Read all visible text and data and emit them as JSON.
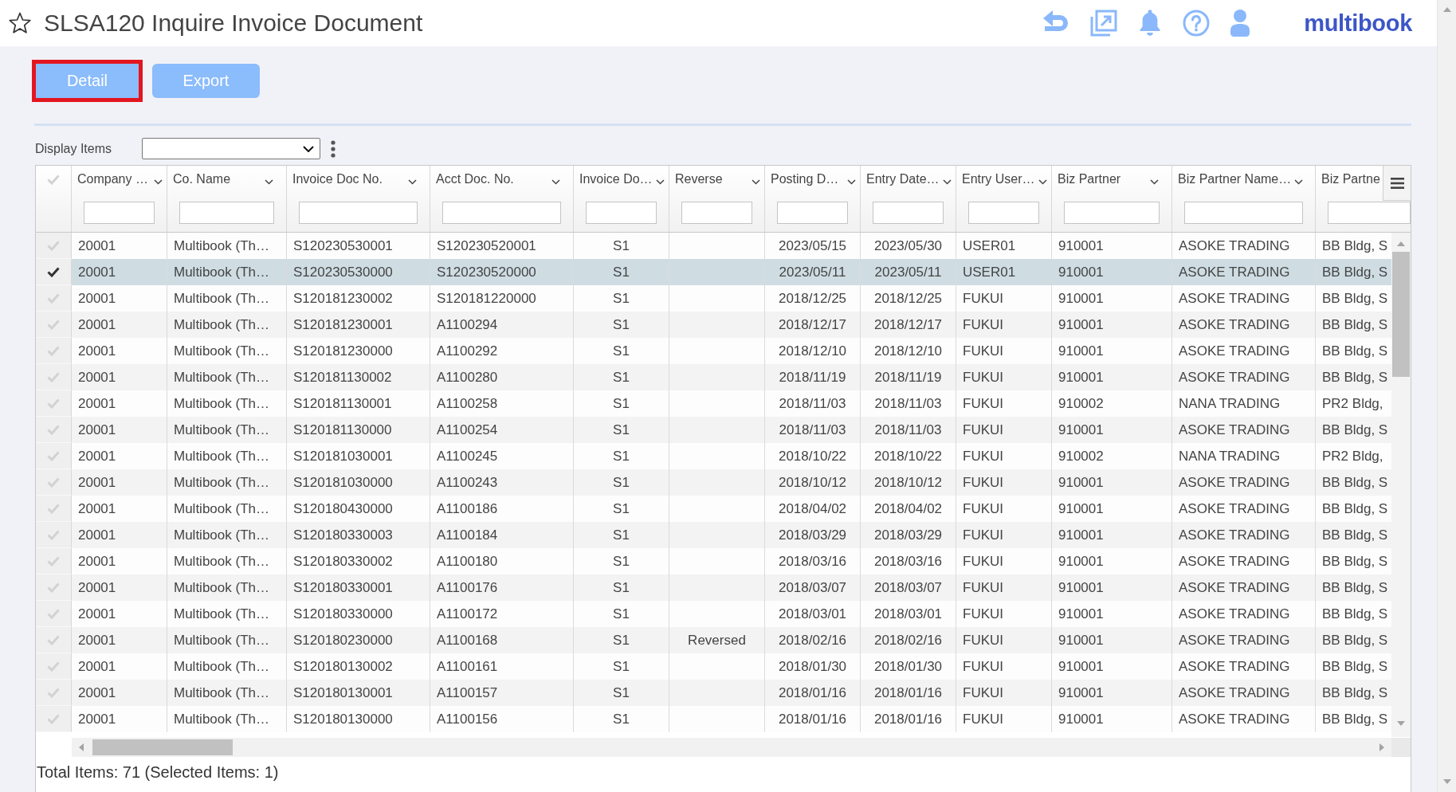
{
  "header": {
    "favorite": false,
    "title": "SLSA120 Inquire Invoice Document",
    "logo": "multibook"
  },
  "toolbar": {
    "buttons": [
      {
        "label": "Detail",
        "focused": true
      },
      {
        "label": "Export",
        "focused": false
      }
    ]
  },
  "display_items": {
    "label": "Display Items"
  },
  "table": {
    "select_all_checked": false,
    "columns": [
      {
        "label": "Company …"
      },
      {
        "label": "Co. Name"
      },
      {
        "label": "Invoice Doc No."
      },
      {
        "label": "Acct Doc. No."
      },
      {
        "label": "Invoice Do…"
      },
      {
        "label": "Reverse"
      },
      {
        "label": "Posting D…"
      },
      {
        "label": "Entry Date…"
      },
      {
        "label": "Entry User…"
      },
      {
        "label": "Biz Partner"
      },
      {
        "label": "Biz Partner Name…"
      },
      {
        "label": "Biz Partne"
      }
    ],
    "rows": [
      {
        "selected": false,
        "company": "20001",
        "co_name": "Multibook (Th…",
        "invoice_doc_no": "S120230530001",
        "acct_doc_no": "S120230520001",
        "invoice_do": "S1",
        "posting_d": "2023/05/15",
        "entry_date": "2023/05/30",
        "entry_user": "USER01",
        "biz_partner": "910001",
        "biz_partner_name": "ASOKE TRADING",
        "biz_partne": "BB Bldg, S"
      },
      {
        "selected": true,
        "company": "20001",
        "co_name": "Multibook (Th…",
        "invoice_doc_no": "S120230530000",
        "acct_doc_no": "S120230520000",
        "invoice_do": "S1",
        "posting_d": "2023/05/11",
        "entry_date": "2023/05/11",
        "entry_user": "USER01",
        "biz_partner": "910001",
        "biz_partner_name": "ASOKE TRADING",
        "biz_partne": "BB Bldg, S"
      },
      {
        "selected": false,
        "company": "20001",
        "co_name": "Multibook (Th…",
        "invoice_doc_no": "S120181230002",
        "acct_doc_no": "S120181220000",
        "invoice_do": "S1",
        "posting_d": "2018/12/25",
        "entry_date": "2018/12/25",
        "entry_user": "FUKUI",
        "biz_partner": "910001",
        "biz_partner_name": "ASOKE TRADING",
        "biz_partne": "BB Bldg, S"
      },
      {
        "selected": false,
        "company": "20001",
        "co_name": "Multibook (Th…",
        "invoice_doc_no": "S120181230001",
        "acct_doc_no": "A1100294",
        "invoice_do": "S1",
        "posting_d": "2018/12/17",
        "entry_date": "2018/12/17",
        "entry_user": "FUKUI",
        "biz_partner": "910001",
        "biz_partner_name": "ASOKE TRADING",
        "biz_partne": "BB Bldg, S"
      },
      {
        "selected": false,
        "company": "20001",
        "co_name": "Multibook (Th…",
        "invoice_doc_no": "S120181230000",
        "acct_doc_no": "A1100292",
        "invoice_do": "S1",
        "posting_d": "2018/12/10",
        "entry_date": "2018/12/10",
        "entry_user": "FUKUI",
        "biz_partner": "910001",
        "biz_partner_name": "ASOKE TRADING",
        "biz_partne": "BB Bldg, S"
      },
      {
        "selected": false,
        "company": "20001",
        "co_name": "Multibook (Th…",
        "invoice_doc_no": "S120181130002",
        "acct_doc_no": "A1100280",
        "invoice_do": "S1",
        "posting_d": "2018/11/19",
        "entry_date": "2018/11/19",
        "entry_user": "FUKUI",
        "biz_partner": "910001",
        "biz_partner_name": "ASOKE TRADING",
        "biz_partne": "BB Bldg, S"
      },
      {
        "selected": false,
        "company": "20001",
        "co_name": "Multibook (Th…",
        "invoice_doc_no": "S120181130001",
        "acct_doc_no": "A1100258",
        "invoice_do": "S1",
        "posting_d": "2018/11/03",
        "entry_date": "2018/11/03",
        "entry_user": "FUKUI",
        "biz_partner": "910002",
        "biz_partner_name": "NANA TRADING",
        "biz_partne": "PR2 Bldg,"
      },
      {
        "selected": false,
        "company": "20001",
        "co_name": "Multibook (Th…",
        "invoice_doc_no": "S120181130000",
        "acct_doc_no": "A1100254",
        "invoice_do": "S1",
        "posting_d": "2018/11/03",
        "entry_date": "2018/11/03",
        "entry_user": "FUKUI",
        "biz_partner": "910001",
        "biz_partner_name": "ASOKE TRADING",
        "biz_partne": "BB Bldg, S"
      },
      {
        "selected": false,
        "company": "20001",
        "co_name": "Multibook (Th…",
        "invoice_doc_no": "S120181030001",
        "acct_doc_no": "A1100245",
        "invoice_do": "S1",
        "posting_d": "2018/10/22",
        "entry_date": "2018/10/22",
        "entry_user": "FUKUI",
        "biz_partner": "910002",
        "biz_partner_name": "NANA TRADING",
        "biz_partne": "PR2 Bldg,"
      },
      {
        "selected": false,
        "company": "20001",
        "co_name": "Multibook (Th…",
        "invoice_doc_no": "S120181030000",
        "acct_doc_no": "A1100243",
        "invoice_do": "S1",
        "posting_d": "2018/10/12",
        "entry_date": "2018/10/12",
        "entry_user": "FUKUI",
        "biz_partner": "910001",
        "biz_partner_name": "ASOKE TRADING",
        "biz_partne": "BB Bldg, S"
      },
      {
        "selected": false,
        "company": "20001",
        "co_name": "Multibook (Th…",
        "invoice_doc_no": "S120180430000",
        "acct_doc_no": "A1100186",
        "invoice_do": "S1",
        "posting_d": "2018/04/02",
        "entry_date": "2018/04/02",
        "entry_user": "FUKUI",
        "biz_partner": "910001",
        "biz_partner_name": "ASOKE TRADING",
        "biz_partne": "BB Bldg, S"
      },
      {
        "selected": false,
        "company": "20001",
        "co_name": "Multibook (Th…",
        "invoice_doc_no": "S120180330003",
        "acct_doc_no": "A1100184",
        "invoice_do": "S1",
        "posting_d": "2018/03/29",
        "entry_date": "2018/03/29",
        "entry_user": "FUKUI",
        "biz_partner": "910001",
        "biz_partner_name": "ASOKE TRADING",
        "biz_partne": "BB Bldg, S"
      },
      {
        "selected": false,
        "company": "20001",
        "co_name": "Multibook (Th…",
        "invoice_doc_no": "S120180330002",
        "acct_doc_no": "A1100180",
        "invoice_do": "S1",
        "posting_d": "2018/03/16",
        "entry_date": "2018/03/16",
        "entry_user": "FUKUI",
        "biz_partner": "910001",
        "biz_partner_name": "ASOKE TRADING",
        "biz_partne": "BB Bldg, S"
      },
      {
        "selected": false,
        "company": "20001",
        "co_name": "Multibook (Th…",
        "invoice_doc_no": "S120180330001",
        "acct_doc_no": "A1100176",
        "invoice_do": "S1",
        "posting_d": "2018/03/07",
        "entry_date": "2018/03/07",
        "entry_user": "FUKUI",
        "biz_partner": "910001",
        "biz_partner_name": "ASOKE TRADING",
        "biz_partne": "BB Bldg, S"
      },
      {
        "selected": false,
        "company": "20001",
        "co_name": "Multibook (Th…",
        "invoice_doc_no": "S120180330000",
        "acct_doc_no": "A1100172",
        "invoice_do": "S1",
        "posting_d": "2018/03/01",
        "entry_date": "2018/03/01",
        "entry_user": "FUKUI",
        "biz_partner": "910001",
        "biz_partner_name": "ASOKE TRADING",
        "biz_partne": "BB Bldg, S"
      },
      {
        "selected": false,
        "company": "20001",
        "co_name": "Multibook (Th…",
        "invoice_doc_no": "S120180230000",
        "acct_doc_no": "A1100168",
        "invoice_do": "S1",
        "reverse": "Reversed",
        "posting_d": "2018/02/16",
        "entry_date": "2018/02/16",
        "entry_user": "FUKUI",
        "biz_partner": "910001",
        "biz_partner_name": "ASOKE TRADING",
        "biz_partne": "BB Bldg, S"
      },
      {
        "selected": false,
        "company": "20001",
        "co_name": "Multibook (Th…",
        "invoice_doc_no": "S120180130002",
        "acct_doc_no": "A1100161",
        "invoice_do": "S1",
        "posting_d": "2018/01/30",
        "entry_date": "2018/01/30",
        "entry_user": "FUKUI",
        "biz_partner": "910001",
        "biz_partner_name": "ASOKE TRADING",
        "biz_partne": "BB Bldg, S"
      },
      {
        "selected": false,
        "company": "20001",
        "co_name": "Multibook (Th…",
        "invoice_doc_no": "S120180130001",
        "acct_doc_no": "A1100157",
        "invoice_do": "S1",
        "posting_d": "2018/01/16",
        "entry_date": "2018/01/16",
        "entry_user": "FUKUI",
        "biz_partner": "910001",
        "biz_partner_name": "ASOKE TRADING",
        "biz_partne": "BB Bldg, S"
      },
      {
        "selected": false,
        "company": "20001",
        "co_name": "Multibook (Th…",
        "invoice_doc_no": "S120180130000",
        "acct_doc_no": "A1100156",
        "invoice_do": "S1",
        "posting_d": "2018/01/16",
        "entry_date": "2018/01/16",
        "entry_user": "FUKUI",
        "biz_partner": "910001",
        "biz_partner_name": "ASOKE TRADING",
        "biz_partne": "BB Bldg, S"
      }
    ]
  },
  "status_bar": {
    "text": "Total Items: 71 (Selected Items: 1)"
  }
}
